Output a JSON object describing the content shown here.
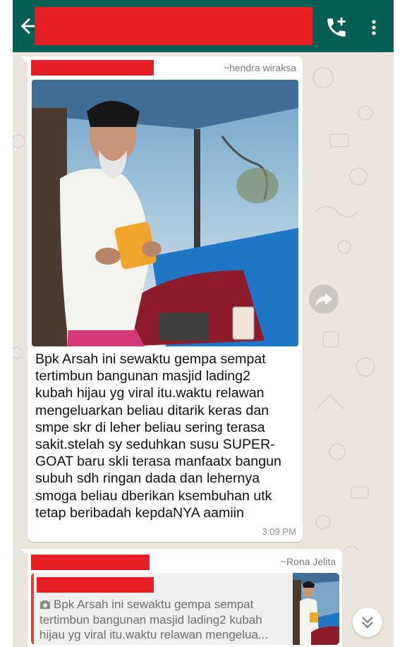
{
  "chat": {
    "icons": {
      "back": "arrow-left-icon",
      "call": "phone-plus-icon",
      "menu": "more-vertical-icon",
      "share": "share-arrow-icon",
      "scroll_down": "double-chevron-down-icon",
      "camera": "camera-icon"
    },
    "colors": {
      "app_bar": "#075e54",
      "chat_background": "#ece5dd",
      "redaction": "#e81e25",
      "quote_bar": "#e0413d"
    }
  },
  "messages": [
    {
      "push_name": "~hendra wiraksa",
      "has_photo": true,
      "caption_lines": [
        "Bpk Arsah ini sewaktu gempa sempat",
        "tertimbun bangunan masjid lading2",
        "kubah hijau yg viral itu.waktu relawan",
        "mengeluarkan beliau ditarik keras dan",
        "smpe skr di leher beliau sering terasa",
        "sakit.stelah sy seduhkan susu SUPER-",
        "GOAT baru skli terasa manfaatx bangun",
        "subuh sdh ringan dada dan lehernya",
        "smoga beliau dberikan ksembuhan utk",
        "tetap beribadah kepdaNYA aamiin"
      ],
      "time": "3:09 PM"
    },
    {
      "push_name": "~Rona Jelita",
      "quoted": {
        "text_lines": [
          "Bpk Arsah ini sewaktu gempa sempat",
          "tertimbun bangunan masjid lading2 kubah",
          "hijau yg viral itu.waktu relawan mengelua..."
        ]
      }
    }
  ]
}
